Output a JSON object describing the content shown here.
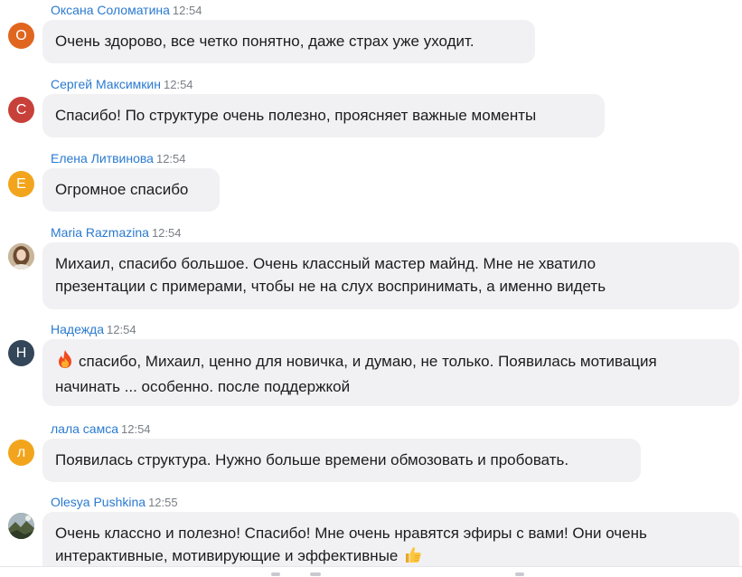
{
  "messages": [
    {
      "author": "Оксана Соломатина",
      "time": "12:54",
      "avatar_letter": "О",
      "avatar_color": "#e0661f",
      "text": "Очень здорово, все четко понятно, даже страх уже уходит."
    },
    {
      "author": "Сергей Максимкин",
      "time": "12:54",
      "avatar_letter": "С",
      "avatar_color": "#c8403a",
      "text": "Спасибо! По структуре очень полезно, проясняет важные моменты"
    },
    {
      "author": "Елена Литвинова",
      "time": "12:54",
      "avatar_letter": "Е",
      "avatar_color": "#f2a51c",
      "text": "Огромное спасибо"
    },
    {
      "author": "Maria Razmazina",
      "time": "12:54",
      "avatar_letter": "",
      "avatar_color": "#b9a48a",
      "avatar_type": "photo",
      "text_line1": "Михаил, спасибо большое. Очень классный мастер майнд. Мне не хватило",
      "text_line2": "презентации с примерами, чтобы не на слух воспринимать, а именно видеть"
    },
    {
      "author": "Надежда",
      "time": "12:54",
      "avatar_letter": "Н",
      "avatar_color": "#34465a",
      "emoji": "fire-emoji",
      "text_line1": "спасибо, Михаил, ценно для новичка, и думаю, не только. Появилась мотивация",
      "text_line2": "начинать ... особенно. после поддержкой"
    },
    {
      "author": "лала самса",
      "time": "12:54",
      "avatar_letter": "л",
      "avatar_color": "#f2a51c",
      "text": "Появилась структура. Нужно больше времени обмозовать и пробовать."
    },
    {
      "author": "Olesya Pushkina",
      "time": "12:55",
      "avatar_letter": "",
      "avatar_color": "#7c8c6a",
      "avatar_type": "photo",
      "emoji_after": "thumbs-up-emoji",
      "text_line1": "Очень классно и полезно! Спасибо! Мне очень нравятся эфиры с вами! Они очень",
      "text_line2": "интерактивные, мотивирующие и эффективные"
    }
  ],
  "colors": {
    "author_name": "#2a7ad0",
    "timestamp": "#7a7f85",
    "bubble_background": "#f1f1f4",
    "message_text": "#1c1c1c"
  }
}
